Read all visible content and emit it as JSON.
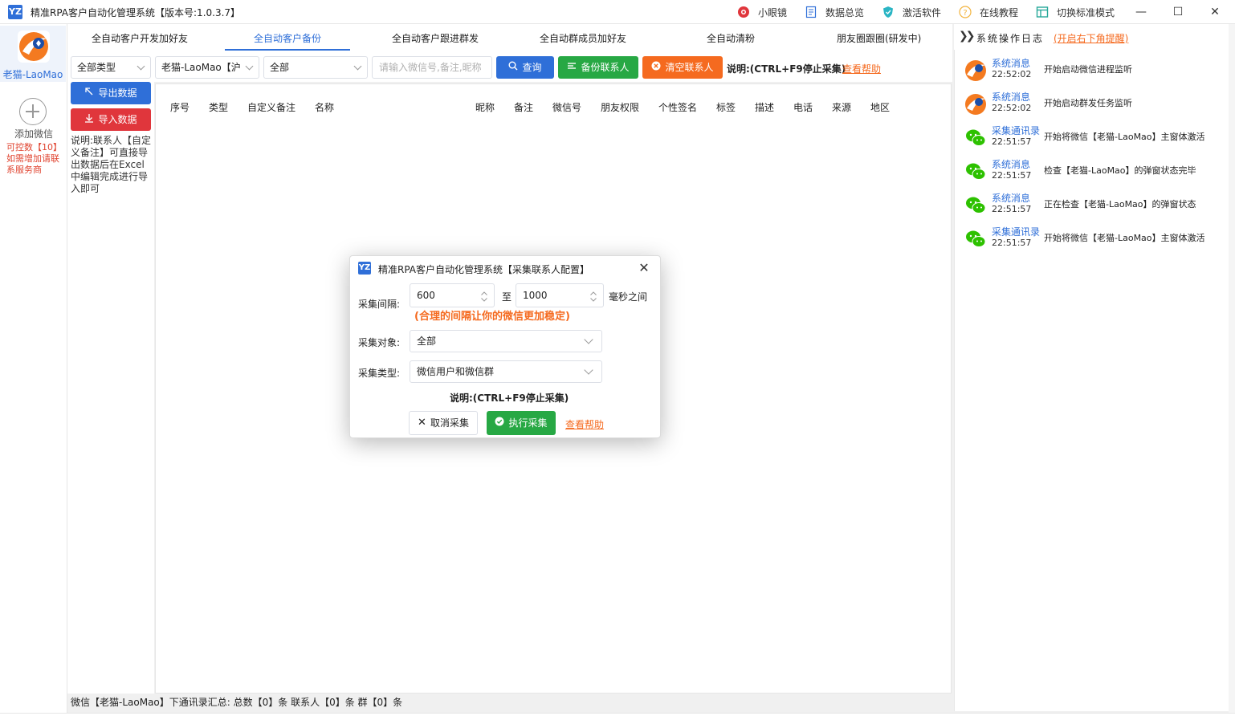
{
  "window": {
    "title": "精准RPA客户自动化管理系统【版本号:1.0.3.7】",
    "logo_text": "YZ",
    "menu": {
      "eye": "小眼镜",
      "data_overview": "数据总览",
      "activate": "激活软件",
      "tutorial": "在线教程",
      "switch_mode": "切换标准模式"
    }
  },
  "rail": {
    "account_name": "老猫-LaoMao",
    "add_label": "添加微信",
    "quota_note": "可控数【10】如需增加请联系服务商"
  },
  "tabs": [
    {
      "label": "全自动客户开发加好友"
    },
    {
      "label": "全自动客户备份"
    },
    {
      "label": "全自动客户跟进群发"
    },
    {
      "label": "全自动群成员加好友"
    },
    {
      "label": "全自动清粉"
    },
    {
      "label": "朋友圈跟圈(研发中)"
    }
  ],
  "toolbar": {
    "type_select": "全部类型",
    "account_select": "老猫-LaoMao【沪",
    "scope_select": "全部",
    "search_placeholder": "请输入微信号,备注,昵称",
    "query_label": "查询",
    "backup_label": "备份联系人",
    "clear_label": "清空联系人",
    "stop_hint": "说明:(CTRL+F9停止采集)",
    "help_link": "查看帮助"
  },
  "side": {
    "export_label": "导出数据",
    "import_label": "导入数据",
    "note": "说明:联系人【自定义备注】可直接导出数据后在Excel中编辑完成进行导入即可"
  },
  "table": {
    "columns": [
      "序号",
      "类型",
      "自定义备注",
      "名称",
      "昵称",
      "备注",
      "微信号",
      "朋友权限",
      "个性签名",
      "标签",
      "描述",
      "电话",
      "来源",
      "地区"
    ]
  },
  "statusbar": {
    "summary": "微信【老猫-LaoMao】下通讯录汇总: 总数【0】条 联系人【0】条 群【0】条"
  },
  "log": {
    "header_title": "系统操作日志",
    "header_link": "(开启右下角提醒)",
    "items": [
      {
        "source": "系统消息",
        "time": "22:52:02",
        "message": "开始启动微信进程监听",
        "icon": "app-logo-icon"
      },
      {
        "source": "系统消息",
        "time": "22:52:02",
        "message": "开始启动群发任务监听",
        "icon": "app-logo-icon"
      },
      {
        "source": "采集通讯录",
        "time": "22:51:57",
        "message": "开始将微信【老猫-LaoMao】主窗体激活",
        "icon": "wechat-icon"
      },
      {
        "source": "系统消息",
        "time": "22:51:57",
        "message": "检查【老猫-LaoMao】的弹窗状态完毕",
        "icon": "wechat-icon"
      },
      {
        "source": "系统消息",
        "time": "22:51:57",
        "message": "正在检查【老猫-LaoMao】的弹窗状态",
        "icon": "wechat-icon"
      },
      {
        "source": "采集通讯录",
        "time": "22:51:57",
        "message": "开始将微信【老猫-LaoMao】主窗体激活",
        "icon": "wechat-icon"
      }
    ]
  },
  "modal": {
    "title": "精准RPA客户自动化管理系统【采集联系人配置】",
    "interval_label": "采集间隔:",
    "interval_min": "600",
    "interval_to": "至",
    "interval_max": "1000",
    "interval_unit": "毫秒之间",
    "interval_tip": "(合理的间隔让你的微信更加稳定)",
    "target_label": "采集对象:",
    "target_value": "全部",
    "type_label": "采集类型:",
    "type_value": "微信用户和微信群",
    "stop_hint": "说明:(CTRL+F9停止采集)",
    "cancel_label": "取消采集",
    "run_label": "执行采集",
    "help_link": "查看帮助"
  },
  "colors": {
    "accent_blue": "#2f6fd8",
    "success_green": "#27a844",
    "warning_orange": "#f56a1f",
    "danger_red": "#e0363c",
    "wechat_green": "#2dc100"
  }
}
